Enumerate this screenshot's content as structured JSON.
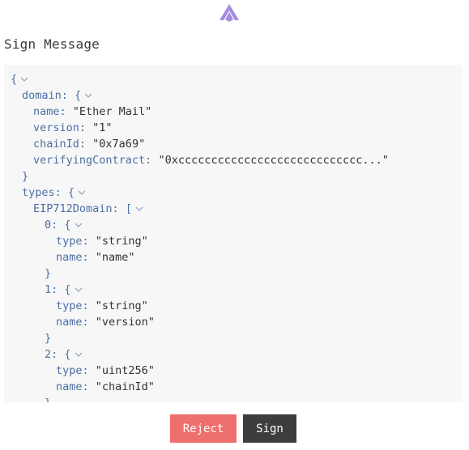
{
  "header": {
    "title": "Sign Message",
    "logo_icon": "arbitrum-logo-icon"
  },
  "colors": {
    "accent": "#a58ce0",
    "reject": "#ef6f6c",
    "sign": "#3d3d3d",
    "key": "#4a6fa5",
    "panel": "#f7f7f7"
  },
  "message": {
    "lines": [
      {
        "depth": 0,
        "key": "",
        "value": "",
        "punct": "{",
        "collapsible": true
      },
      {
        "depth": 1,
        "key": "domain",
        "value": "",
        "punct": "{",
        "collapsible": true
      },
      {
        "depth": 2,
        "key": "name",
        "value": "\"Ether Mail\"",
        "punct": "",
        "collapsible": false
      },
      {
        "depth": 2,
        "key": "version",
        "value": "\"1\"",
        "punct": "",
        "collapsible": false
      },
      {
        "depth": 2,
        "key": "chainId",
        "value": "\"0x7a69\"",
        "punct": "",
        "collapsible": false
      },
      {
        "depth": 2,
        "key": "verifyingContract",
        "value": "\"0xcccccccccccccccccccccccccccc...\"",
        "punct": "",
        "collapsible": false
      },
      {
        "depth": 1,
        "key": "",
        "value": "",
        "punct": "}",
        "collapsible": false
      },
      {
        "depth": 1,
        "key": "types",
        "value": "",
        "punct": "{",
        "collapsible": true
      },
      {
        "depth": 2,
        "key": "EIP712Domain",
        "value": "",
        "punct": "[",
        "collapsible": true
      },
      {
        "depth": 3,
        "key": "0",
        "value": "",
        "punct": "{",
        "collapsible": true
      },
      {
        "depth": 4,
        "key": "type",
        "value": "\"string\"",
        "punct": "",
        "collapsible": false
      },
      {
        "depth": 4,
        "key": "name",
        "value": "\"name\"",
        "punct": "",
        "collapsible": false
      },
      {
        "depth": 3,
        "key": "",
        "value": "",
        "punct": "}",
        "collapsible": false
      },
      {
        "depth": 3,
        "key": "1",
        "value": "",
        "punct": "{",
        "collapsible": true
      },
      {
        "depth": 4,
        "key": "type",
        "value": "\"string\"",
        "punct": "",
        "collapsible": false
      },
      {
        "depth": 4,
        "key": "name",
        "value": "\"version\"",
        "punct": "",
        "collapsible": false
      },
      {
        "depth": 3,
        "key": "",
        "value": "",
        "punct": "}",
        "collapsible": false
      },
      {
        "depth": 3,
        "key": "2",
        "value": "",
        "punct": "{",
        "collapsible": true
      },
      {
        "depth": 4,
        "key": "type",
        "value": "\"uint256\"",
        "punct": "",
        "collapsible": false
      },
      {
        "depth": 4,
        "key": "name",
        "value": "\"chainId\"",
        "punct": "",
        "collapsible": false
      },
      {
        "depth": 3,
        "key": "",
        "value": "",
        "punct": "}",
        "collapsible": false
      }
    ]
  },
  "actions": {
    "reject_label": "Reject",
    "sign_label": "Sign"
  }
}
